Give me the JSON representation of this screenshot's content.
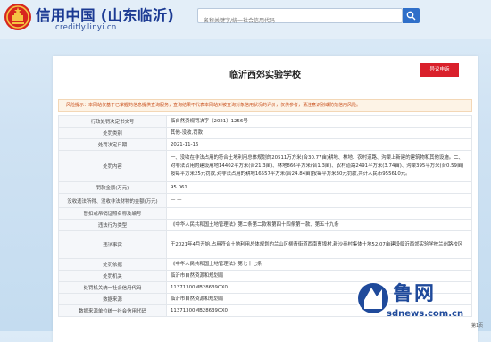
{
  "header": {
    "site_title": "信用中国 (山东临沂)",
    "site_url": "creditly.linyi.cn",
    "search_placeholder": "名称关键字/统一社会信用代码"
  },
  "record": {
    "name": "临沂西郊实验学校",
    "objection_label": "异议申诉",
    "notice": "风险提示：本网站仅基于已掌握的信息提供查询服务，查询结果不代表本网站对被查询对象信用状况的评价，仅供参考，请注意识别或防范信用风险。"
  },
  "fields": [
    {
      "label": "行政处罚决定书文号",
      "value": "临自然资规罚决字〔2021〕1256号"
    },
    {
      "label": "处罚类别",
      "value": "其他-没收,罚款"
    },
    {
      "label": "处罚决定日期",
      "value": "2021-11-16"
    },
    {
      "label": "处罚内容",
      "value": "一、没收在非法占用的符合土地利用总体规划的20511万方米(合30.77亩)耕地、林地、农村道路、沟渠上新建的建筑物和其他设施。二、对非法占用的建设用地14402平方米(合21.3亩)、林地866平方米(合1.3亩)、农村道路2491平方米(3.74亩)、沟渠395平方米(合0.59亩)按每平方米25元罚款,对非法占用的耕地16557平方米(合24.84亩)按每平方米30元罚款,共计人民币955610元。"
    },
    {
      "label": "罚款金额(万元)",
      "value": "95.061"
    },
    {
      "label": "没收违法所得、没收非法财物的金额(万元)",
      "value": "— —"
    },
    {
      "label": "暂扣或吊销证照名称及编号",
      "value": "— —"
    },
    {
      "label": "违法行为类型",
      "value": "《中华人民共和国土地管理法》第二条第二款和第四十四条第一款、第五十九条"
    },
    {
      "label": "违法事实",
      "value": "于2021年4月开始,占用符合土地利用总体规划的兰山区柳青街道西南曹埠村,新沙奉村集体土地52.07亩建设临沂西郊实验学校兰州路校区"
    },
    {
      "label": "处罚依据",
      "value": "《中华人民共和国土地管理法》第七十七条"
    },
    {
      "label": "处罚机关",
      "value": "临沂市自然资源和规划局"
    },
    {
      "label": "处罚机关统一社会信用代码",
      "value": "11371300MB28639OX0"
    },
    {
      "label": "数据来源",
      "value": "临沂市自然资源和规划局"
    },
    {
      "label": "数据来源单位统一社会信用代码",
      "value": "11371300MB28639OX0"
    }
  ],
  "watermark": {
    "brand": "鲁网",
    "url": "sdnews.com.cn"
  },
  "page_indicator": "第1页"
}
